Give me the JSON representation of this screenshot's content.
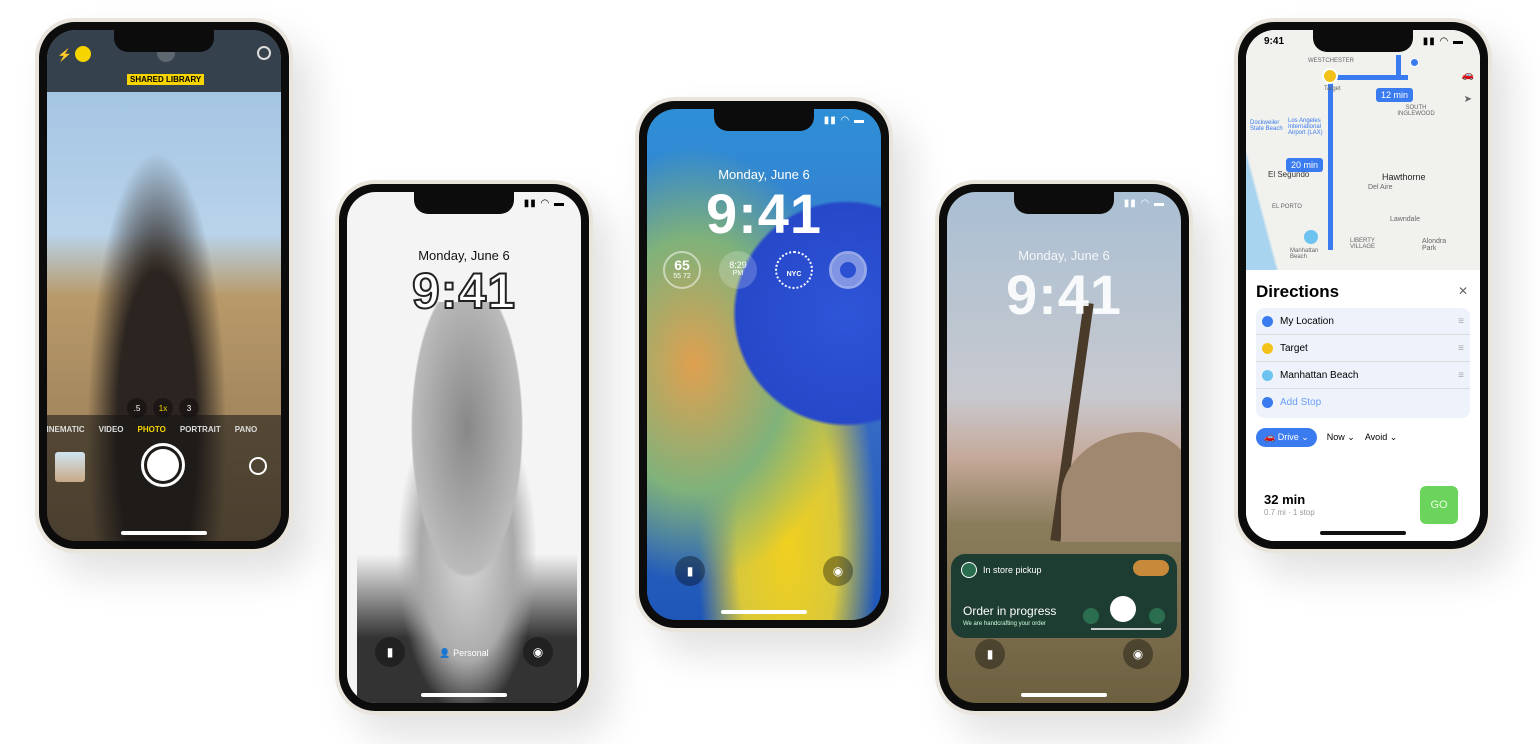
{
  "camera": {
    "badge": "SHARED LIBRARY",
    "zoom": [
      ".5",
      "1x",
      "3"
    ],
    "modes": [
      "CINEMATIC",
      "VIDEO",
      "PHOTO",
      "PORTRAIT",
      "PANO"
    ],
    "active_mode": "PHOTO",
    "accent": "#f5d400"
  },
  "lock_bw": {
    "date": "Monday, June 6",
    "time": "9:41",
    "focus": "Personal"
  },
  "lock_color": {
    "date": "Monday, June 6",
    "time": "9:41",
    "widgets": {
      "temp": "65",
      "low": "55",
      "high": "72",
      "clock_time": "8:29",
      "clock_ampm": "PM",
      "city": "NYC"
    }
  },
  "lock_desert": {
    "date": "Monday, June 6",
    "time": "9:41",
    "activity": {
      "title": "In store pickup",
      "status": "Order in progress",
      "subtitle": "We are handcrafting your order",
      "brand_color": "#1e3d32"
    }
  },
  "maps": {
    "status_time": "9:41",
    "labels": {
      "westchester": "WESTCHESTER",
      "target": "Target",
      "south_inglewood": "SOUTH INGLEWOOD",
      "dockweiler": "Dockweiler State Beach",
      "lax": "Los Angeles International Airport (LAX)",
      "el_segundo": "El Segundo",
      "hawthorne": "Hawthorne",
      "del_aire": "Del Aire",
      "el_porto": "EL PORTO",
      "lawndale": "Lawndale",
      "liberty": "LIBERTY VILLAGE",
      "alondra": "Alondra Park",
      "manhattan": "Manhattan Beach"
    },
    "eta1": "12 min",
    "eta2": "20 min",
    "sheet": {
      "title": "Directions",
      "stops": [
        "My Location",
        "Target",
        "Manhattan Beach"
      ],
      "add_stop": "Add Stop",
      "drive": "Drive",
      "now": "Now",
      "avoid": "Avoid",
      "duration": "32 min",
      "detail": "0.7 mi · 1 stop",
      "go": "GO"
    },
    "accent": "#3a7bf0",
    "go_color": "#6ad45c"
  }
}
